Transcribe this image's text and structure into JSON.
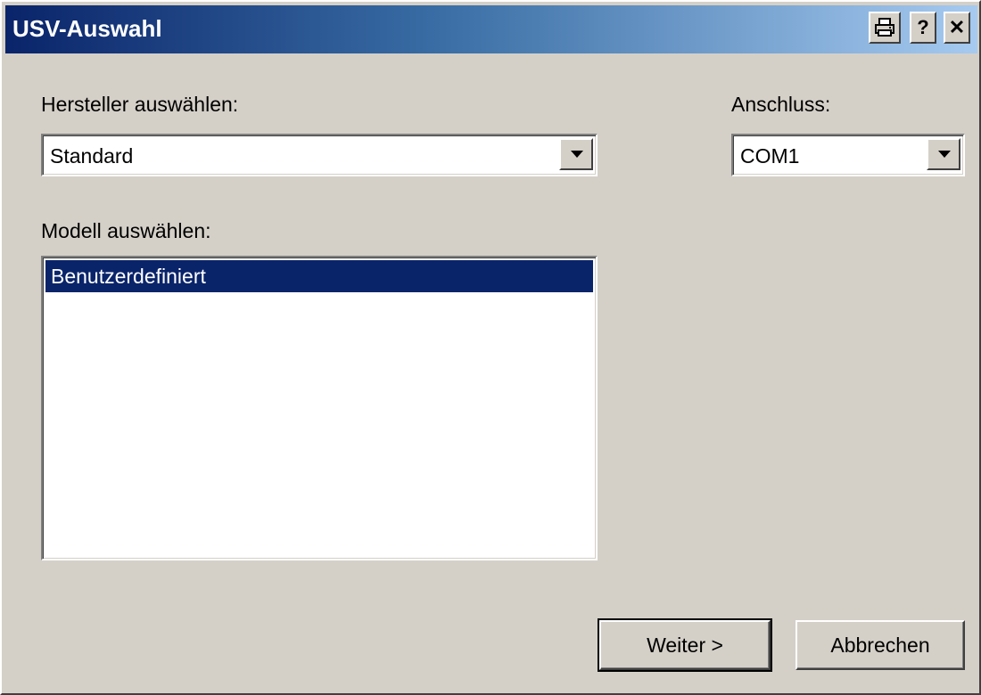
{
  "window": {
    "title": "USV-Auswahl",
    "title_buttons": {
      "print_icon": "printer-icon",
      "help": "?",
      "close": "✕"
    }
  },
  "manufacturer": {
    "label": "Hersteller auswählen:",
    "selected": "Standard"
  },
  "port": {
    "label": "Anschluss:",
    "selected": "COM1"
  },
  "model": {
    "label": "Modell auswählen:",
    "items": [
      {
        "label": "Benutzerdefiniert",
        "selected": true
      }
    ]
  },
  "buttons": {
    "next": "Weiter >",
    "cancel": "Abbrechen"
  },
  "colors": {
    "titlebar_start": "#0a246a",
    "titlebar_end": "#a6caf0",
    "selection": "#0a246a",
    "face": "#d4d0c8"
  }
}
